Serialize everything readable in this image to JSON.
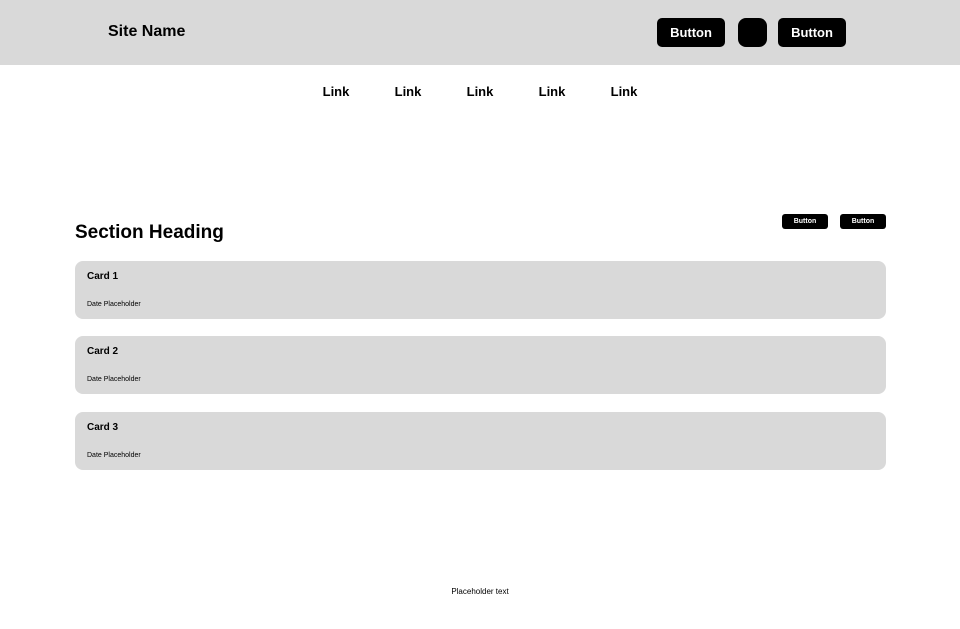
{
  "header": {
    "site_name": "Site Name",
    "buttons": [
      "Button",
      "Button"
    ]
  },
  "nav": {
    "links": [
      "Link",
      "Link",
      "Link",
      "Link",
      "Link"
    ]
  },
  "section": {
    "heading": "Section Heading",
    "buttons": [
      "Button",
      "Button"
    ],
    "cards": [
      {
        "title": "Card 1",
        "date": "Date Placeholder"
      },
      {
        "title": "Card 2",
        "date": "Date Placeholder"
      },
      {
        "title": "Card 3",
        "date": "Date Placeholder"
      }
    ]
  },
  "footer": {
    "text": "Placeholder text"
  },
  "colors": {
    "header_bg": "#d9d9d9",
    "card_bg": "#d9d9d9",
    "button_bg": "#000000",
    "button_text": "#ffffff"
  }
}
